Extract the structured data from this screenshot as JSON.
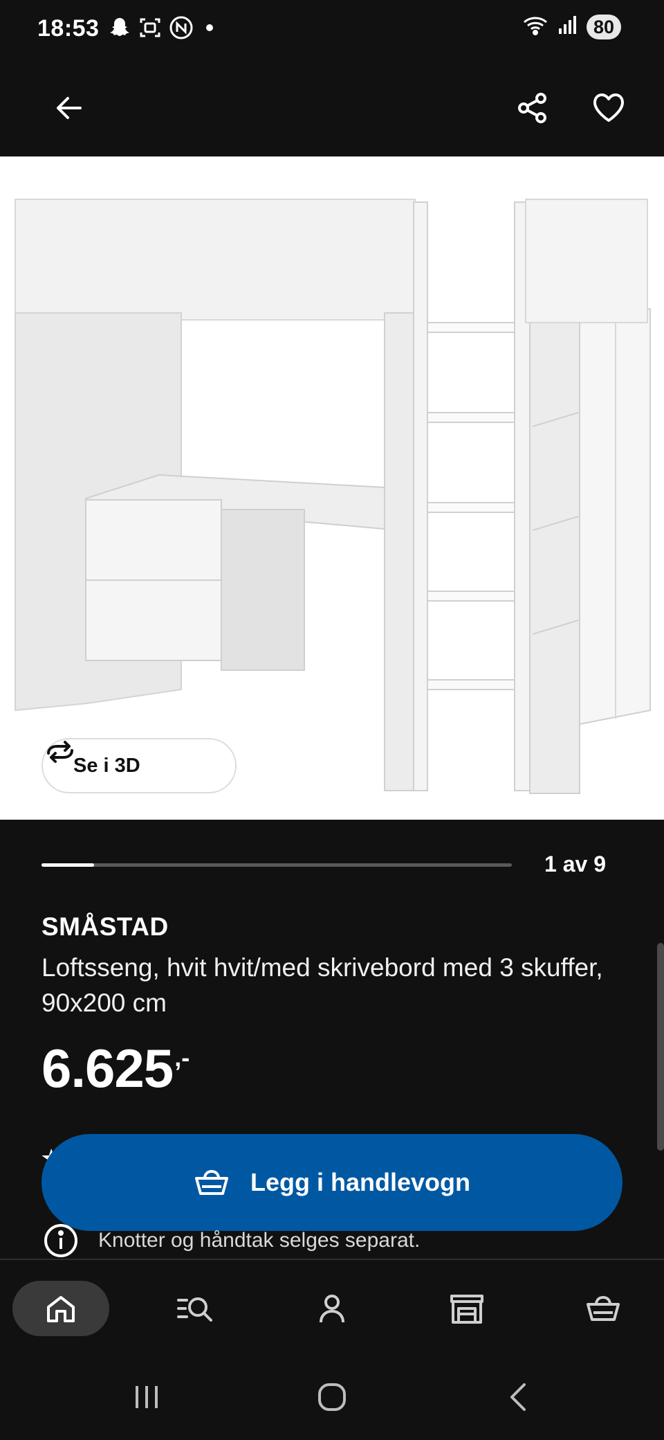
{
  "status_bar": {
    "time": "18:53",
    "battery": "80",
    "icons": [
      "snapchat-icon",
      "screen-record-icon",
      "nfc-icon",
      "notification-dot",
      "wifi-icon",
      "signal-icon",
      "battery-icon"
    ]
  },
  "header": {
    "icons": [
      "back-arrow-icon",
      "share-icon",
      "heart-icon"
    ]
  },
  "gallery": {
    "see_3d_label": "Se i 3D",
    "page_indicator": "1 av 9",
    "current": 1,
    "total": 9
  },
  "product": {
    "name": "SMÅSTAD",
    "description": "Loftsseng, hvit hvit/med skrivebord med 3 skuffer, 90x200 cm",
    "price_main": "6.625",
    "price_suffix": ",-"
  },
  "actions": {
    "add_to_cart_label": "Legg i handlevogn",
    "info_note": "Knotter og håndtak selges separat."
  },
  "bottom_nav": {
    "items": [
      "home-icon",
      "search-list-icon",
      "profile-icon",
      "store-icon",
      "cart-icon"
    ],
    "active": "home-icon"
  },
  "colors": {
    "background": "#111111",
    "accent_blue": "#0058a3",
    "image_bg": "#ffffff"
  }
}
